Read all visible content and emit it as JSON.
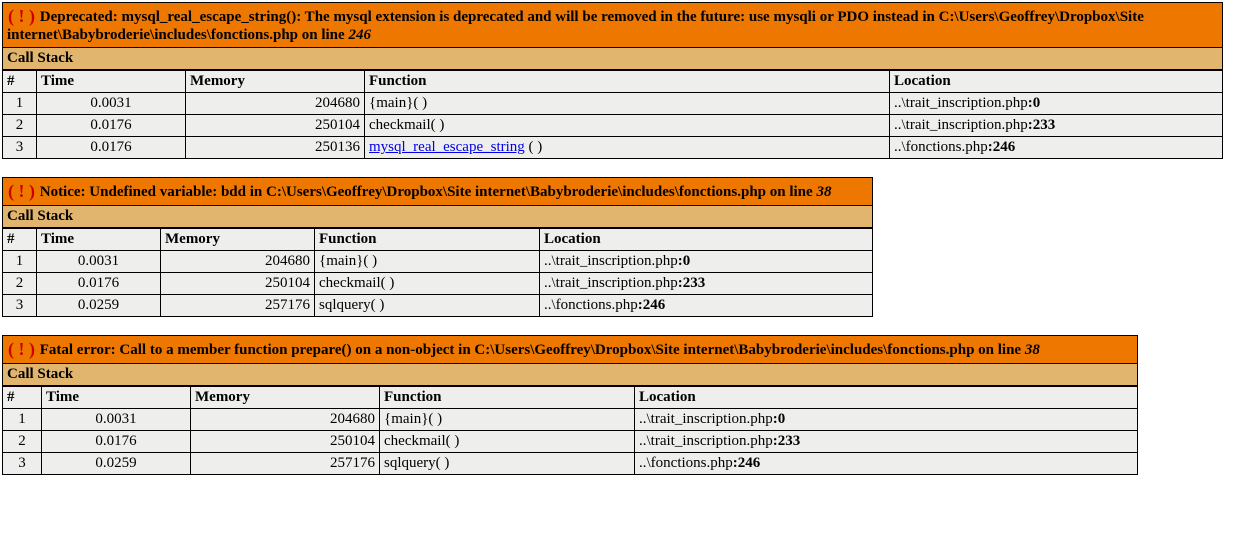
{
  "errors": [
    {
      "type": "Deprecated",
      "message": "mysql_real_escape_string(): The mysql extension is deprecated and will be removed in the future: use mysqli or PDO instead in C:\\Users\\Geoffrey\\Dropbox\\Site internet\\Babybroderie\\includes\\fonctions.php on line ",
      "line": "246",
      "widths": {
        "num": 25,
        "time": 140,
        "mem": 170,
        "fn": 516
      },
      "stack": [
        {
          "n": "1",
          "time": "0.0031",
          "mem": "204680",
          "fn": "{main}( )",
          "link": null,
          "loc_pre": "..\\trait_inscription.php",
          "loc_post": ":0"
        },
        {
          "n": "2",
          "time": "0.0176",
          "mem": "250104",
          "fn": "checkmail( )",
          "link": null,
          "loc_pre": "..\\trait_inscription.php",
          "loc_post": ":233"
        },
        {
          "n": "3",
          "time": "0.0176",
          "mem": "250136",
          "fn": "mysql_real_escape_string",
          "link": true,
          "fn_tail": " ( )",
          "loc_pre": "..\\fonctions.php",
          "loc_post": ":246"
        }
      ]
    },
    {
      "type": "Notice",
      "message": "Undefined variable: bdd in C:\\Users\\Geoffrey\\Dropbox\\Site internet\\Babybroderie\\includes\\fonctions.php on line ",
      "line": "38",
      "widths": {
        "num": 25,
        "time": 115,
        "mem": 145,
        "fn": 216
      },
      "stack": [
        {
          "n": "1",
          "time": "0.0031",
          "mem": "204680",
          "fn": "{main}( )",
          "link": null,
          "loc_pre": "..\\trait_inscription.php",
          "loc_post": ":0"
        },
        {
          "n": "2",
          "time": "0.0176",
          "mem": "250104",
          "fn": "checkmail( )",
          "link": null,
          "loc_pre": "..\\trait_inscription.php",
          "loc_post": ":233"
        },
        {
          "n": "3",
          "time": "0.0259",
          "mem": "257176",
          "fn": "sqlquery( )",
          "link": null,
          "loc_pre": "..\\fonctions.php",
          "loc_post": ":246"
        }
      ]
    },
    {
      "type": "Fatal error",
      "message": "Call to a member function prepare() on a non-object in C:\\Users\\Geoffrey\\Dropbox\\Site internet\\Babybroderie\\includes\\fonctions.php on line ",
      "line": "38",
      "widths": {
        "num": 30,
        "time": 140,
        "mem": 180,
        "fn": 246
      },
      "stack": [
        {
          "n": "1",
          "time": "0.0031",
          "mem": "204680",
          "fn": "{main}( )",
          "link": null,
          "loc_pre": "..\\trait_inscription.php",
          "loc_post": ":0"
        },
        {
          "n": "2",
          "time": "0.0176",
          "mem": "250104",
          "fn": "checkmail( )",
          "link": null,
          "loc_pre": "..\\trait_inscription.php",
          "loc_post": ":233"
        },
        {
          "n": "3",
          "time": "0.0259",
          "mem": "257176",
          "fn": "sqlquery( )",
          "link": null,
          "loc_pre": "..\\fonctions.php",
          "loc_post": ":246"
        }
      ]
    }
  ],
  "labels": {
    "callstack": "Call Stack",
    "col_num": "#",
    "col_time": "Time",
    "col_mem": "Memory",
    "col_fn": "Function",
    "col_loc": "Location"
  }
}
